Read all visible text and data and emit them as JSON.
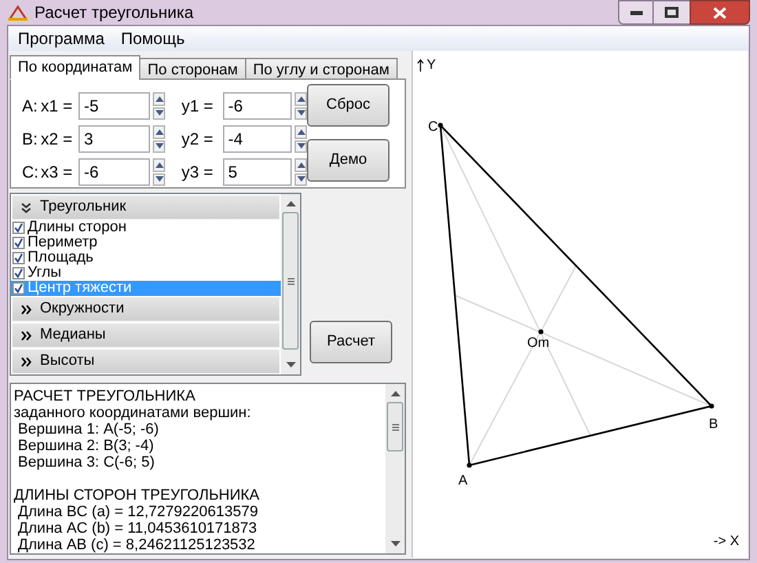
{
  "window": {
    "title": "Расчет треугольника"
  },
  "menu": [
    "Программа",
    "Помощь"
  ],
  "tabs": [
    {
      "label": "По координатам",
      "selected": true
    },
    {
      "label": "По сторонам",
      "selected": false
    },
    {
      "label": "По углу и сторонам",
      "selected": false
    }
  ],
  "coordinates": [
    {
      "point": "A:",
      "x_label": "x1 =",
      "x_value": "-5",
      "y_label": "y1 =",
      "y_value": "-6"
    },
    {
      "point": "B:",
      "x_label": "x2 =",
      "x_value": "3",
      "y_label": "y2 =",
      "y_value": "-4"
    },
    {
      "point": "C:",
      "x_label": "x3 =",
      "x_value": "-6",
      "y_label": "y3 =",
      "y_value": "5"
    }
  ],
  "buttons": [
    "Сброс",
    "Демо"
  ],
  "sections": [
    {
      "title": "Треугольник",
      "expanded": true,
      "items": [
        {
          "label": "Длины сторон",
          "checked": true,
          "selected": false
        },
        {
          "label": "Периметр",
          "checked": true,
          "selected": false
        },
        {
          "label": "Площадь",
          "checked": true,
          "selected": false
        },
        {
          "label": "Углы",
          "checked": true,
          "selected": false
        },
        {
          "label": "Центр тяжести",
          "checked": true,
          "selected": true
        }
      ]
    },
    {
      "title": "Окружности",
      "expanded": false
    },
    {
      "title": "Медианы",
      "expanded": false
    },
    {
      "title": "Высоты",
      "expanded": false
    }
  ],
  "calculate_button": "Расчет",
  "output": [
    [
      "РАСЧЕТ ТРЕУГОЛЬНИКА",
      "заданного координатами вершин:",
      " Вершина 1: A(-5; -6)",
      " Вершина 2: B(3; -4)",
      " Вершина 3: C(-6; 5)"
    ],
    [
      "ДЛИНЫ СТОРОН ТРЕУГОЛЬНИКА",
      " Длина BC (a) = 12,7279220613579",
      " Длина AC (b) = 11,0453610171873",
      " Длина AB (c) = 8,24621125123532"
    ]
  ],
  "plot": {
    "y_axis": "Y",
    "x_axis": "-> X",
    "vertices": [
      "A",
      "B",
      "C"
    ],
    "centroid": "Om"
  }
}
